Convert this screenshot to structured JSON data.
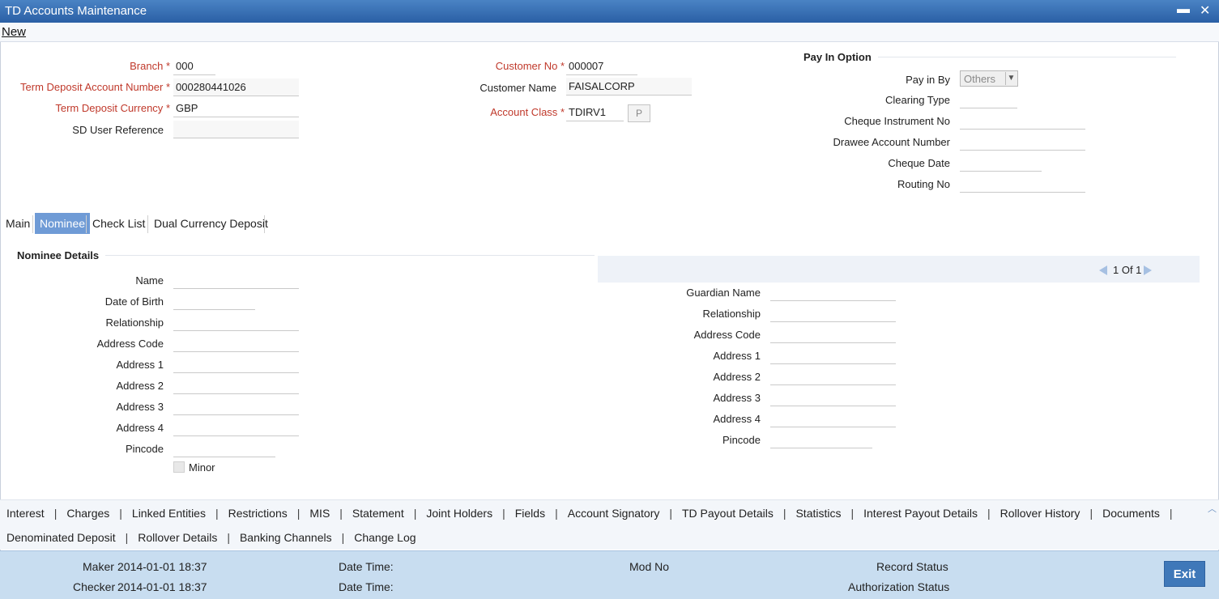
{
  "window": {
    "title": "TD Accounts Maintenance",
    "minimize_glyph": "▬",
    "close_glyph": "✕"
  },
  "menu": {
    "new_label": "New"
  },
  "header": {
    "branch": {
      "label": "Branch",
      "required_mark": "*",
      "value": "000"
    },
    "td_account_number": {
      "label": "Term Deposit Account Number",
      "required_mark": "*",
      "value": "000280441026"
    },
    "td_currency": {
      "label": "Term Deposit Currency",
      "required_mark": "*",
      "value": "GBP"
    },
    "sd_user_reference": {
      "label": "SD User Reference",
      "value": ""
    },
    "customer_no": {
      "label": "Customer No",
      "required_mark": "*",
      "value": "000007"
    },
    "customer_name": {
      "label": "Customer Name",
      "value": "FAISALCORP"
    },
    "account_class": {
      "label": "Account Class",
      "required_mark": "*",
      "value": "TDIRV1",
      "button_label": "P"
    }
  },
  "pay_in": {
    "title": "Pay In Option",
    "pay_in_by": {
      "label": "Pay in By",
      "value": "Others"
    },
    "clearing_type": {
      "label": "Clearing Type",
      "value": ""
    },
    "cheque_instrument_no": {
      "label": "Cheque Instrument No",
      "value": ""
    },
    "drawee_account_number": {
      "label": "Drawee Account Number",
      "value": ""
    },
    "cheque_date": {
      "label": "Cheque Date",
      "value": ""
    },
    "routing_no": {
      "label": "Routing No",
      "value": ""
    }
  },
  "tabs": [
    {
      "label": "Main",
      "active": false
    },
    {
      "label": "Nominee",
      "active": true
    },
    {
      "label": "Check List",
      "active": false
    },
    {
      "label": "Dual Currency Deposit",
      "active": false
    }
  ],
  "nominee": {
    "title": "Nominee Details",
    "pager": "1 Of 1",
    "left_fields": [
      {
        "label": "Name",
        "value": ""
      },
      {
        "label": "Date of Birth",
        "value": ""
      },
      {
        "label": "Relationship",
        "value": ""
      },
      {
        "label": "Address Code",
        "value": ""
      },
      {
        "label": "Address 1",
        "value": ""
      },
      {
        "label": "Address 2",
        "value": ""
      },
      {
        "label": "Address 3",
        "value": ""
      },
      {
        "label": "Address 4",
        "value": ""
      },
      {
        "label": "Pincode",
        "value": ""
      }
    ],
    "minor_label": "Minor",
    "minor_checked": false,
    "right_fields": [
      {
        "label": "Guardian Name",
        "value": ""
      },
      {
        "label": "Relationship",
        "value": ""
      },
      {
        "label": "Address Code",
        "value": ""
      },
      {
        "label": "Address 1",
        "value": ""
      },
      {
        "label": "Address 2",
        "value": ""
      },
      {
        "label": "Address 3",
        "value": ""
      },
      {
        "label": "Address 4",
        "value": ""
      },
      {
        "label": "Pincode",
        "value": ""
      }
    ]
  },
  "sub_links_row1": [
    "Interest",
    "Charges",
    "Linked Entities",
    "Restrictions",
    "MIS",
    "Statement",
    "Joint Holders",
    "Fields",
    "Account Signatory",
    "TD Payout Details",
    "Statistics",
    "Interest Payout Details",
    "Rollover History",
    "Documents"
  ],
  "sub_links_row2": [
    "Denominated Deposit",
    "Rollover Details",
    "Banking Channels",
    "Change Log"
  ],
  "link_separator": "|",
  "footer": {
    "maker_label": "Maker",
    "maker_value": "2014-01-01 18:37",
    "checker_label": "Checker",
    "checker_value": "2014-01-01 18:37",
    "date_time_label": "Date Time:",
    "mod_no_label": "Mod No",
    "record_status_label": "Record Status",
    "auth_status_label": "Authorization Status",
    "exit_label": "Exit"
  }
}
